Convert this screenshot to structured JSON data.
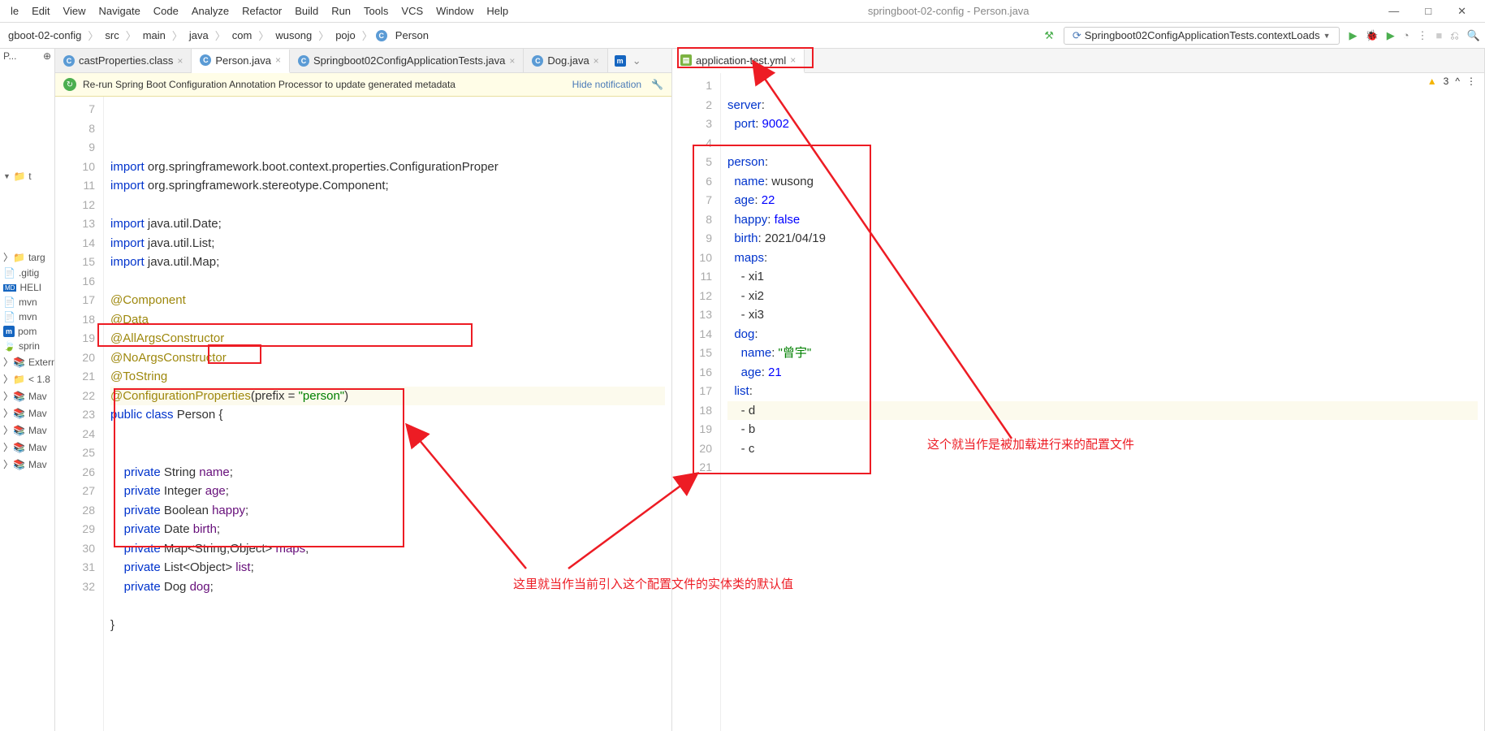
{
  "menu": [
    "le",
    "Edit",
    "View",
    "Navigate",
    "Code",
    "Analyze",
    "Refactor",
    "Build",
    "Run",
    "Tools",
    "VCS",
    "Window",
    "Help"
  ],
  "titlebar": "springboot-02-config - Person.java",
  "breadcrumbs": [
    "gboot-02-config",
    "src",
    "main",
    "java",
    "com",
    "wusong",
    "pojo",
    "Person"
  ],
  "run_config": "Springboot02ConfigApplicationTests.contextLoads",
  "sidebar": {
    "items": [
      "P...",
      "",
      "te",
      "targ",
      ".gitig",
      "HELI",
      "mvn",
      "mvn",
      "pom",
      "sprin",
      "Externa",
      "< 1.8",
      "Mav",
      "Mav",
      "Mav",
      "Mav",
      "Mav"
    ]
  },
  "tabs_left": [
    {
      "label": "castProperties.class",
      "icon": "c",
      "active": false
    },
    {
      "label": "Person.java",
      "icon": "c",
      "active": true
    },
    {
      "label": "Springboot02ConfigApplicationTests.java",
      "icon": "c",
      "active": false
    },
    {
      "label": "Dog.java",
      "icon": "c",
      "active": false
    }
  ],
  "tabs_right": [
    {
      "label": "application-test.yml",
      "icon": "yml",
      "active": true
    }
  ],
  "banner": {
    "text": "Re-run Spring Boot Configuration Annotation Processor to update generated metadata",
    "link": "Hide notification"
  },
  "left_gutter_start": 7,
  "left_code": [
    {
      "n": 7,
      "html": "<span class='k'>import</span> org.springframework.boot.context.properties.<span class='cls'>ConfigurationProper</span>"
    },
    {
      "n": 8,
      "html": "<span class='k'>import</span> org.springframework.stereotype.<span class='cls'>Component</span>;"
    },
    {
      "n": 9,
      "html": ""
    },
    {
      "n": 10,
      "html": "<span class='k'>import</span> java.util.<span class='cls'>Date</span>;"
    },
    {
      "n": 11,
      "html": "<span class='k'>import</span> java.util.<span class='cls'>List</span>;"
    },
    {
      "n": 12,
      "html": "<span class='k'>import</span> java.util.<span class='cls'>Map</span>;"
    },
    {
      "n": 13,
      "html": ""
    },
    {
      "n": 14,
      "html": "<span class='ann'>@Component</span>"
    },
    {
      "n": 15,
      "html": "<span class='ann'>@Data</span>"
    },
    {
      "n": 16,
      "html": "<span class='ann'>@AllArgsConstructor</span>"
    },
    {
      "n": 17,
      "html": "<span class='ann'>@NoArgsConstructor</span>"
    },
    {
      "n": 18,
      "html": "<span class='ann'>@ToString</span>"
    },
    {
      "n": 19,
      "html": "<span class='ann'>@ConfigurationProperties</span>(prefix = <span class='str'>\"person\"</span>)",
      "hl": true
    },
    {
      "n": 20,
      "html": "<span class='k'>public class</span> <span class='cls'>Person</span> {"
    },
    {
      "n": 21,
      "html": ""
    },
    {
      "n": 22,
      "html": ""
    },
    {
      "n": 23,
      "html": "    <span class='k'>private</span> String <span class='fld'>name</span>;"
    },
    {
      "n": 24,
      "html": "    <span class='k'>private</span> Integer <span class='fld'>age</span>;"
    },
    {
      "n": 25,
      "html": "    <span class='k'>private</span> Boolean <span class='fld'>happy</span>;"
    },
    {
      "n": 26,
      "html": "    <span class='k'>private</span> Date <span class='fld'>birth</span>;"
    },
    {
      "n": 27,
      "html": "    <span class='k'>private</span> Map&lt;String,Object&gt; <span class='fld'>maps</span>;"
    },
    {
      "n": 28,
      "html": "    <span class='k'>private</span> List&lt;Object&gt; <span class='fld'>list</span>;"
    },
    {
      "n": 29,
      "html": "    <span class='k'>private</span> Dog <span class='fld'>dog</span>;"
    },
    {
      "n": 30,
      "html": ""
    },
    {
      "n": 31,
      "html": "}"
    },
    {
      "n": 32,
      "html": ""
    }
  ],
  "right_code": [
    {
      "n": 1,
      "html": ""
    },
    {
      "n": 2,
      "html": "<span class='yk'>server</span>:"
    },
    {
      "n": 3,
      "html": "  <span class='yk'>port</span>: <span class='yn'>9002</span>"
    },
    {
      "n": 4,
      "html": ""
    },
    {
      "n": 5,
      "html": "<span class='yk'>person</span>:"
    },
    {
      "n": 6,
      "html": "  <span class='yk'>name</span>: wusong"
    },
    {
      "n": 7,
      "html": "  <span class='yk'>age</span>: <span class='yn'>22</span>"
    },
    {
      "n": 8,
      "html": "  <span class='yk'>happy</span>: <span class='yn'>false</span>"
    },
    {
      "n": 9,
      "html": "  <span class='yk'>birth</span>: 2021/04/19"
    },
    {
      "n": 10,
      "html": "  <span class='yk'>maps</span>:"
    },
    {
      "n": 11,
      "html": "    - xi1"
    },
    {
      "n": 12,
      "html": "    - xi2"
    },
    {
      "n": 13,
      "html": "    - xi3"
    },
    {
      "n": 14,
      "html": "  <span class='yk'>dog</span>:"
    },
    {
      "n": 15,
      "html": "    <span class='yk'>name</span>: <span class='ys'>\"曾宇\"</span>"
    },
    {
      "n": 16,
      "html": "    <span class='yk'>age</span>: <span class='yn'>21</span>"
    },
    {
      "n": 17,
      "html": "  <span class='yk'>list</span>:"
    },
    {
      "n": 18,
      "html": "    - d",
      "hl": true
    },
    {
      "n": 19,
      "html": "    - b"
    },
    {
      "n": 20,
      "html": "    - c"
    },
    {
      "n": 21,
      "html": ""
    }
  ],
  "warning_count": "3",
  "annotations": {
    "bottom": "这里就当作当前引入这个配置文件的实体类的默认值",
    "right": "这个就当作是被加载进行来的配置文件"
  }
}
